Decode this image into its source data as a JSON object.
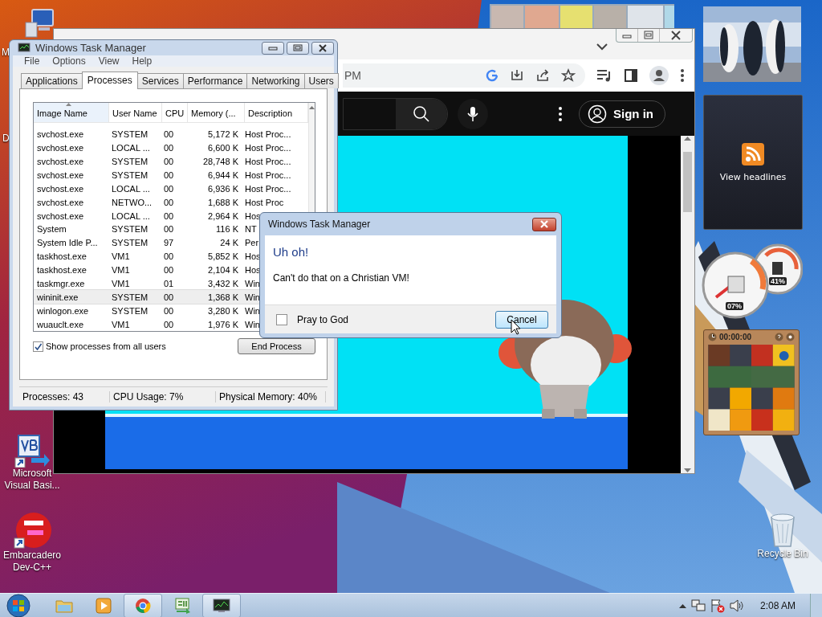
{
  "desktop": {
    "icons": [
      {
        "kind": "computer",
        "label": "M"
      },
      {
        "kind": "blank",
        "label": "D"
      },
      {
        "kind": "vb",
        "label": "Microsoft Visual Basi..."
      },
      {
        "kind": "devcpp",
        "label": "Embarcadero Dev-C++"
      },
      {
        "kind": "recycle",
        "label": "Recycle Bin"
      }
    ]
  },
  "browser": {
    "address_text": "PM",
    "sign_in": "Sign in"
  },
  "task_manager": {
    "title": "Windows Task Manager",
    "menu": [
      "File",
      "Options",
      "View",
      "Help"
    ],
    "tabs": [
      {
        "label": "Applications",
        "selected": false
      },
      {
        "label": "Processes",
        "selected": true
      },
      {
        "label": "Services",
        "selected": false
      },
      {
        "label": "Performance",
        "selected": false
      },
      {
        "label": "Networking",
        "selected": false
      },
      {
        "label": "Users",
        "selected": false
      }
    ],
    "columns": [
      "Image Name",
      "User Name",
      "CPU",
      "Memory (...",
      "Description"
    ],
    "rows": [
      {
        "cells": [
          "svchost.exe",
          "SYSTEM",
          "00",
          "5,172 K",
          "Host Proc..."
        ],
        "selected": false
      },
      {
        "cells": [
          "svchost.exe",
          "LOCAL ...",
          "00",
          "6,600 K",
          "Host Proc..."
        ],
        "selected": false
      },
      {
        "cells": [
          "svchost.exe",
          "SYSTEM",
          "00",
          "28,748 K",
          "Host Proc..."
        ],
        "selected": false
      },
      {
        "cells": [
          "svchost.exe",
          "SYSTEM",
          "00",
          "6,944 K",
          "Host Proc..."
        ],
        "selected": false
      },
      {
        "cells": [
          "svchost.exe",
          "LOCAL ...",
          "00",
          "6,936 K",
          "Host Proc..."
        ],
        "selected": false
      },
      {
        "cells": [
          "svchost.exe",
          "NETWO...",
          "00",
          "1,688 K",
          "Host Proc"
        ],
        "selected": false
      },
      {
        "cells": [
          "svchost.exe",
          "LOCAL ...",
          "00",
          "2,964 K",
          "Hos"
        ],
        "selected": false
      },
      {
        "cells": [
          "System",
          "SYSTEM",
          "00",
          "116 K",
          "NT"
        ],
        "selected": false
      },
      {
        "cells": [
          "System Idle P...",
          "SYSTEM",
          "97",
          "24 K",
          "Per"
        ],
        "selected": false
      },
      {
        "cells": [
          "taskhost.exe",
          "VM1",
          "00",
          "5,852 K",
          "Hos"
        ],
        "selected": false
      },
      {
        "cells": [
          "taskhost.exe",
          "VM1",
          "00",
          "2,104 K",
          "Hos"
        ],
        "selected": false
      },
      {
        "cells": [
          "taskmgr.exe",
          "VM1",
          "01",
          "3,432 K",
          "Win"
        ],
        "selected": false
      },
      {
        "cells": [
          "wininit.exe",
          "SYSTEM",
          "00",
          "1,368 K",
          "Win"
        ],
        "selected": true
      },
      {
        "cells": [
          "winlogon.exe",
          "SYSTEM",
          "00",
          "3,280 K",
          "Win"
        ],
        "selected": false
      },
      {
        "cells": [
          "wuauclt.exe",
          "VM1",
          "00",
          "1,976 K",
          "Win"
        ],
        "selected": false
      }
    ],
    "show_all_users": {
      "label": "Show processes from all users",
      "checked": true
    },
    "end_process": "End Process",
    "status": [
      "Processes: 43",
      "CPU Usage: 7%",
      "Physical Memory: 40%"
    ]
  },
  "dialog": {
    "title": "Windows Task Manager",
    "heading": "Uh oh!",
    "message": "Can't do that on a Christian VM!",
    "checkbox": {
      "label": "Pray to God",
      "checked": false
    },
    "button": "Cancel"
  },
  "gadgets": {
    "feed_label": "View headlines",
    "cpu_reading": "07%",
    "memory_reading": "41%",
    "timer": "00:00:00"
  },
  "taskbar": {
    "apps": [
      {
        "kind": "folder",
        "running": false
      },
      {
        "kind": "media",
        "running": false
      },
      {
        "kind": "chrome",
        "running": true
      },
      {
        "kind": "csharp",
        "running": false
      },
      {
        "kind": "taskmgr",
        "running": true
      }
    ],
    "clock": "2:08 AM"
  }
}
